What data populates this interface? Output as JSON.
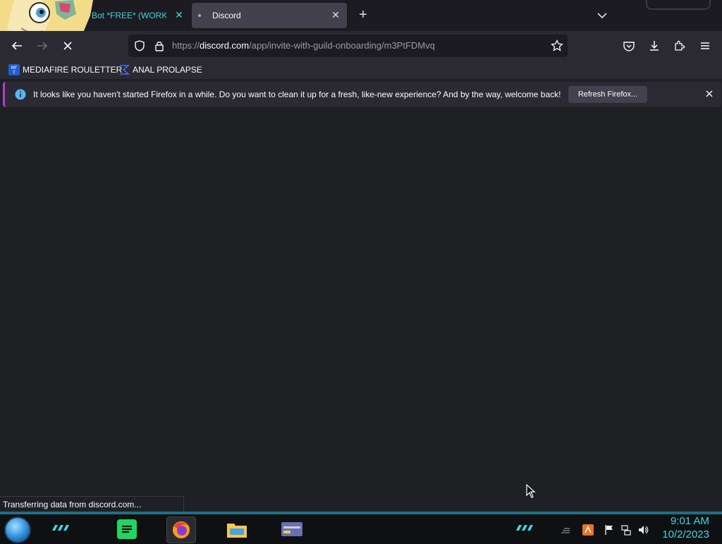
{
  "browser": {
    "tabs": [
      {
        "title": "w Bot *FREE* (WORK",
        "active": false
      },
      {
        "title": "Discord",
        "active": true
      }
    ],
    "url": {
      "prefix": "https://",
      "domain": "discord.com",
      "path": "/app/invite-with-guild-onboarding/m3PtFDMvq"
    },
    "bookmarks": [
      {
        "label": "MEDIAFIRE ROULETTER",
        "icon": "mediafire-icon"
      },
      {
        "label": "ANAL PROLAPSE",
        "icon": "sigma-icon"
      }
    ],
    "notification": {
      "text": "It looks like you haven't started Firefox in a while. Do you want to clean it up for a fresh, like-new experience? And by the way, welcome back!",
      "button": "Refresh Firefox..."
    },
    "status_text": "Transferring data from discord.com..."
  },
  "taskbar": {
    "apps": [
      "spotify-icon",
      "firefox-icon",
      "file-explorer-icon",
      "window-app-icon"
    ],
    "time": "9:01 AM",
    "date": "10/2/2023"
  },
  "colors": {
    "accent": "#3fd6e0",
    "notification_border": "#b53bd6",
    "taskbar_strip": "#1c6f85"
  }
}
